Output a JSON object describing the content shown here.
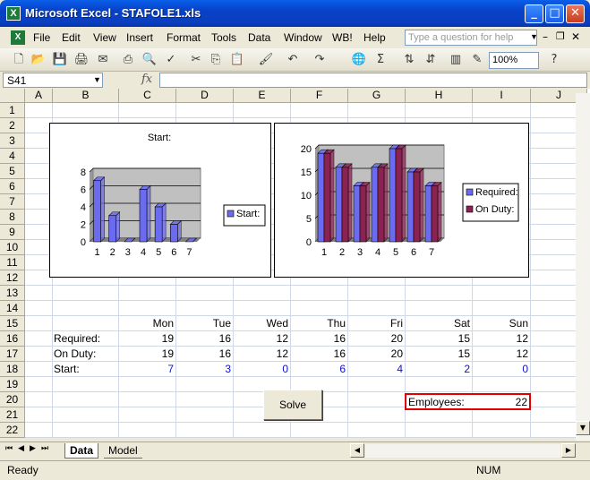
{
  "window": {
    "title": "Microsoft Excel - STAFOLE1.xls",
    "app_icon": "X"
  },
  "menu": [
    "File",
    "Edit",
    "View",
    "Insert",
    "Format",
    "Tools",
    "Data",
    "Window",
    "WB!",
    "Help"
  ],
  "help_placeholder": "Type a question for help",
  "zoom": "100%",
  "name_box": "S41",
  "fx_label": "fx",
  "columns": [
    "A",
    "B",
    "C",
    "D",
    "E",
    "F",
    "G",
    "H",
    "I",
    "J"
  ],
  "rows": [
    "1",
    "2",
    "3",
    "4",
    "5",
    "6",
    "7",
    "8",
    "9",
    "10",
    "11",
    "12",
    "13",
    "14",
    "15",
    "16",
    "17",
    "18",
    "19",
    "20",
    "21",
    "22"
  ],
  "table": {
    "days": [
      "Mon",
      "Tue",
      "Wed",
      "Thu",
      "Fri",
      "Sat",
      "Sun"
    ],
    "rows": [
      {
        "label": "Required:",
        "values": [
          "19",
          "16",
          "12",
          "16",
          "20",
          "15",
          "12"
        ]
      },
      {
        "label": "On Duty:",
        "values": [
          "19",
          "16",
          "12",
          "16",
          "20",
          "15",
          "12"
        ]
      },
      {
        "label": "Start:",
        "values": [
          "7",
          "3",
          "0",
          "6",
          "4",
          "2",
          "0"
        ]
      }
    ]
  },
  "solve_label": "Solve",
  "employees": {
    "label": "Employees:",
    "value": "22"
  },
  "sheets": {
    "active": "Data",
    "other": "Model"
  },
  "status": {
    "left": "Ready",
    "num": "NUM"
  },
  "colors": {
    "bar_blue": "#6b6bf0",
    "bar_maroon": "#8b2252",
    "plot_bg": "#c0c0c0",
    "accent_red": "#e00000"
  },
  "chart_data": [
    {
      "type": "bar",
      "title": "Start:",
      "categories": [
        "1",
        "2",
        "3",
        "4",
        "5",
        "6",
        "7"
      ],
      "series": [
        {
          "name": "Start:",
          "values": [
            7,
            3,
            0,
            6,
            4,
            2,
            0
          ]
        }
      ],
      "ylim": [
        0,
        8
      ],
      "yticks": [
        "0",
        "2",
        "4",
        "6",
        "8"
      ],
      "grid": true,
      "legend": "right"
    },
    {
      "type": "bar",
      "title": "",
      "categories": [
        "1",
        "2",
        "3",
        "4",
        "5",
        "6",
        "7"
      ],
      "series": [
        {
          "name": "Required:",
          "values": [
            19,
            16,
            12,
            16,
            20,
            15,
            12
          ]
        },
        {
          "name": "On Duty:",
          "values": [
            19,
            16,
            12,
            16,
            20,
            15,
            12
          ]
        }
      ],
      "ylim": [
        0,
        20
      ],
      "yticks": [
        "0",
        "5",
        "10",
        "15",
        "20"
      ],
      "grid": true,
      "legend": "right"
    }
  ]
}
